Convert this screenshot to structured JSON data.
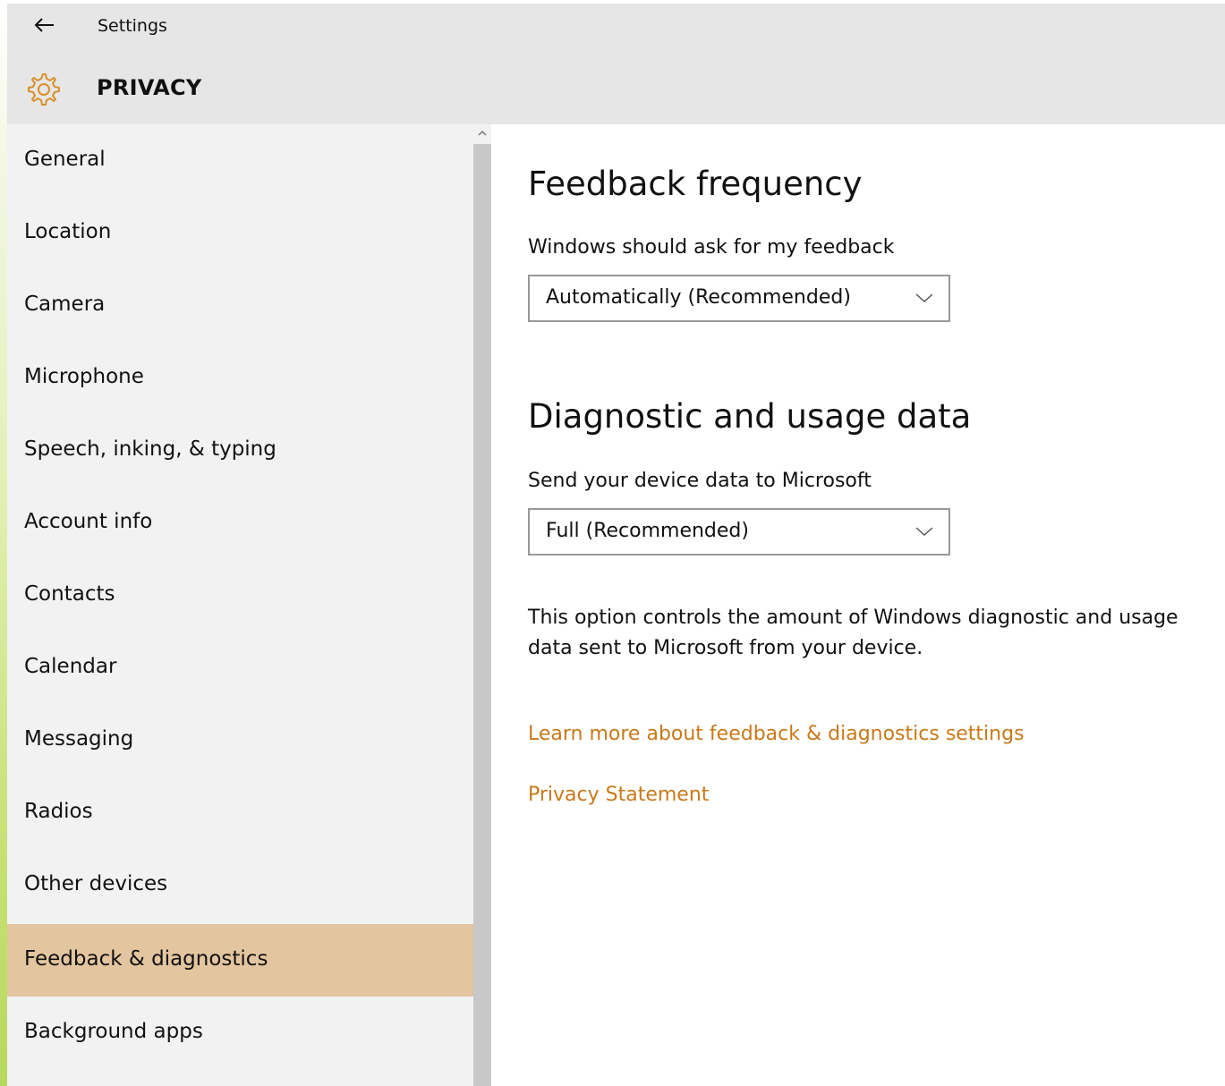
{
  "window": {
    "app_title": "Settings",
    "page_title": "PRIVACY"
  },
  "colors": {
    "accent": "#c8791a",
    "selected_item_bg": "#e3c69f",
    "header_bg": "#e6e6e6",
    "sidebar_bg": "#f2f2f2"
  },
  "icons": {
    "back": "back-arrow-icon",
    "header": "gear-icon",
    "dropdown": "chevron-down-icon"
  },
  "sidebar": {
    "selected": "Feedback & diagnostics",
    "items": [
      {
        "label": "General"
      },
      {
        "label": "Location"
      },
      {
        "label": "Camera"
      },
      {
        "label": "Microphone"
      },
      {
        "label": "Speech, inking, & typing"
      },
      {
        "label": "Account info"
      },
      {
        "label": "Contacts"
      },
      {
        "label": "Calendar"
      },
      {
        "label": "Messaging"
      },
      {
        "label": "Radios"
      },
      {
        "label": "Other devices"
      },
      {
        "label": "Feedback & diagnostics"
      },
      {
        "label": "Background apps"
      }
    ]
  },
  "main": {
    "feedback": {
      "heading": "Feedback frequency",
      "label": "Windows should ask for my feedback",
      "value": "Automatically (Recommended)"
    },
    "diagnostics": {
      "heading": "Diagnostic and usage data",
      "label": "Send your device data to Microsoft",
      "value": "Full (Recommended)",
      "description": "This option controls the amount of Windows diagnostic and usage data sent to Microsoft from your device."
    },
    "links": {
      "learn_more": "Learn more about feedback & diagnostics settings",
      "privacy_statement": "Privacy Statement"
    }
  }
}
